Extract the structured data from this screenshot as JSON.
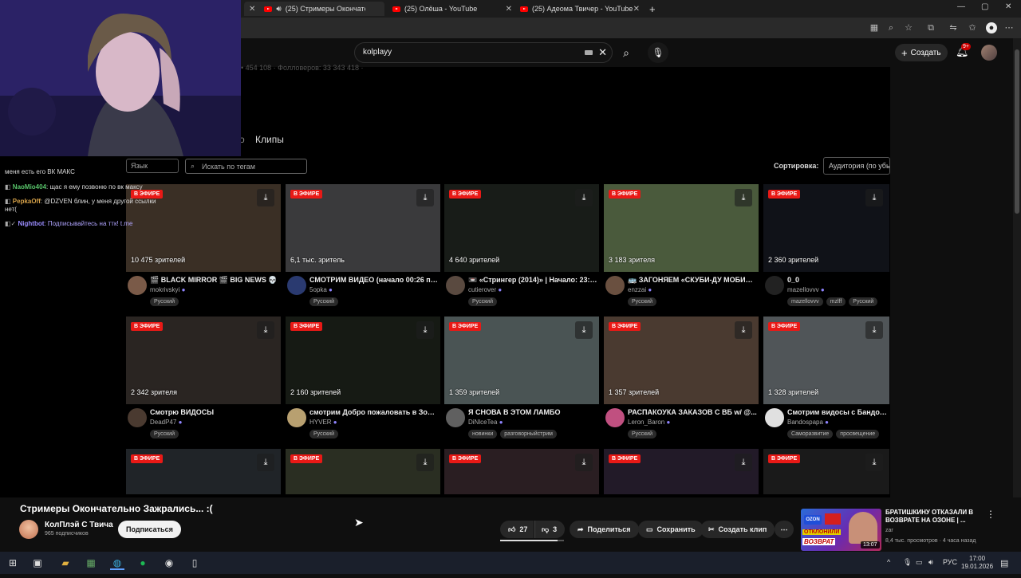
{
  "browser": {
    "tabs": [
      {
        "title": "(25) Стримеры Окончательно Зажрались...",
        "active": true
      },
      {
        "title": "(25) Олёша - YouTube",
        "active": false
      },
      {
        "title": "(25) Адеома Твичер - YouTube",
        "active": false
      }
    ],
    "new_tab": "+",
    "window_controls": [
      "—",
      "▢",
      "✕"
    ]
  },
  "header": {
    "search_value": "kolplayy",
    "create_label": "Создать",
    "notifications_badge": "9+"
  },
  "twitch": {
    "faded_stats": "• 454 108 · Фолловеров: 33 343 418 ·",
    "tab_partial": "о",
    "tab_clips": "Клипы",
    "language_filter": "Язык",
    "tag_search_placeholder": "Искать по тегам",
    "sort_label": "Сортировка:",
    "sort_value": "Аудитория (по убыв.)",
    "live_label": "В ЭФИРЕ"
  },
  "streams": [
    {
      "viewers": "10 475 зрителей",
      "title": "🎬 BLACK MIRROR 🎬 BIG NEWS 💀",
      "channel": "mokrivskyi",
      "tags": [
        "Русский"
      ],
      "thumb": "#3a2f25",
      "av": "#7a5a48"
    },
    {
      "viewers": "6,1 тыс. зритель",
      "title": "СМОТРИМ ВИДЕО (начало 00:26 по мск)",
      "channel": "5opka",
      "tags": [
        "Русский"
      ],
      "thumb": "#3a3a3c",
      "av": "#2a3a70"
    },
    {
      "viewers": "4 640 зрителей",
      "title": "📼 «Стрингер (2014)» | Начало: 23:00",
      "channel": "cutierover",
      "tags": [
        "Русский"
      ],
      "thumb": "#181c18",
      "av": "#5a4a40"
    },
    {
      "viewers": "3 183 зрителя",
      "title": "🚌 ЗАГОНЯЕМ «СКУБИ-ДУ МОБИЛЬ»",
      "channel": "enzzai",
      "tags": [
        "Русский"
      ],
      "thumb": "#4a5a3c",
      "av": "#6a5040"
    },
    {
      "viewers": "2 360 зрителей",
      "title": "0_0",
      "channel": "mazellovvv",
      "tags": [
        "mazellovvv",
        "mzlff",
        "Русский"
      ],
      "thumb": "#101218",
      "av": "#222"
    },
    {
      "viewers": "2 342 зрителя",
      "title": "Смотрю ВИДОСЫ",
      "channel": "DeadP47",
      "tags": [
        "Русский"
      ],
      "thumb": "#2a2522",
      "av": "#4a3a30"
    },
    {
      "viewers": "2 160 зрителей",
      "title": "смотрим Добро пожаловать в Зомбилэнд",
      "channel": "HYVER",
      "tags": [
        "Русский"
      ],
      "thumb": "#161a14",
      "av": "#b8a070"
    },
    {
      "viewers": "1 359 зрителей",
      "title": "Я СНОВА В ЭТОМ ЛАМБО",
      "channel": "DiNlceTea",
      "tags": [
        "новинки",
        "разговорныйстрим"
      ],
      "thumb": "#4a5454",
      "av": "#606060"
    },
    {
      "viewers": "1 357 зрителей",
      "title": "РАСПАКОУКА ЗАКАЗОВ С ВБ w/ @...",
      "channel": "Leron_Baron",
      "tags": [
        "Русский"
      ],
      "thumb": "#4a3a30",
      "av": "#c05080"
    },
    {
      "viewers": "1 328 зрителей",
      "title": "Смотрим видосы с Бандосом",
      "channel": "Bandospapa",
      "tags": [
        "Саморазвитие",
        "просвещение"
      ],
      "thumb": "#505558",
      "av": "#e0e0e0"
    },
    {
      "thumb": "#202428"
    },
    {
      "thumb": "#2a2e22"
    },
    {
      "thumb": "#2a1e22"
    },
    {
      "thumb": "#221a28"
    },
    {
      "thumb": "#1a1a1a"
    }
  ],
  "chat": {
    "lines": [
      {
        "text": "меня есть его ВК МАКС"
      },
      {
        "user": "NaoMio404",
        "text": ": щас я ему позвоню по вк максу"
      },
      {
        "user": "PepkaOff",
        "text": ": @DZVEN блин, у меня другой ссылки нет("
      },
      {
        "user": "Nightbot",
        "text": ": Подписывайтесь на ттк! t.me"
      }
    ]
  },
  "video": {
    "title": "Стримеры Окончательно Зажрались... :(",
    "channel": "КолПлэй С Твича",
    "subscribers": "965 подписчиков",
    "subscribe_label": "Подписаться",
    "likes": "27",
    "dislikes": "3",
    "like_ratio": 0.9,
    "share_label": "Поделиться",
    "save_label": "Сохранить",
    "clip_label": "Создать клип"
  },
  "recommended": {
    "title": "БРАТИШКИНУ ОТКАЗАЛИ В ВОЗВРАТЕ НА ОЗОНЕ | ...",
    "channel": "zar",
    "meta": "8,4 тыс. просмотров · 4 часа назад",
    "duration": "13:07",
    "thumb_text_1": "OZON",
    "thumb_text_2": "ОТКЛОНИЛИ",
    "thumb_text_3": "ВОЗВРАТ"
  },
  "taskbar": {
    "lang": "РУС",
    "time": "17:00",
    "date": "19.01.2026"
  }
}
